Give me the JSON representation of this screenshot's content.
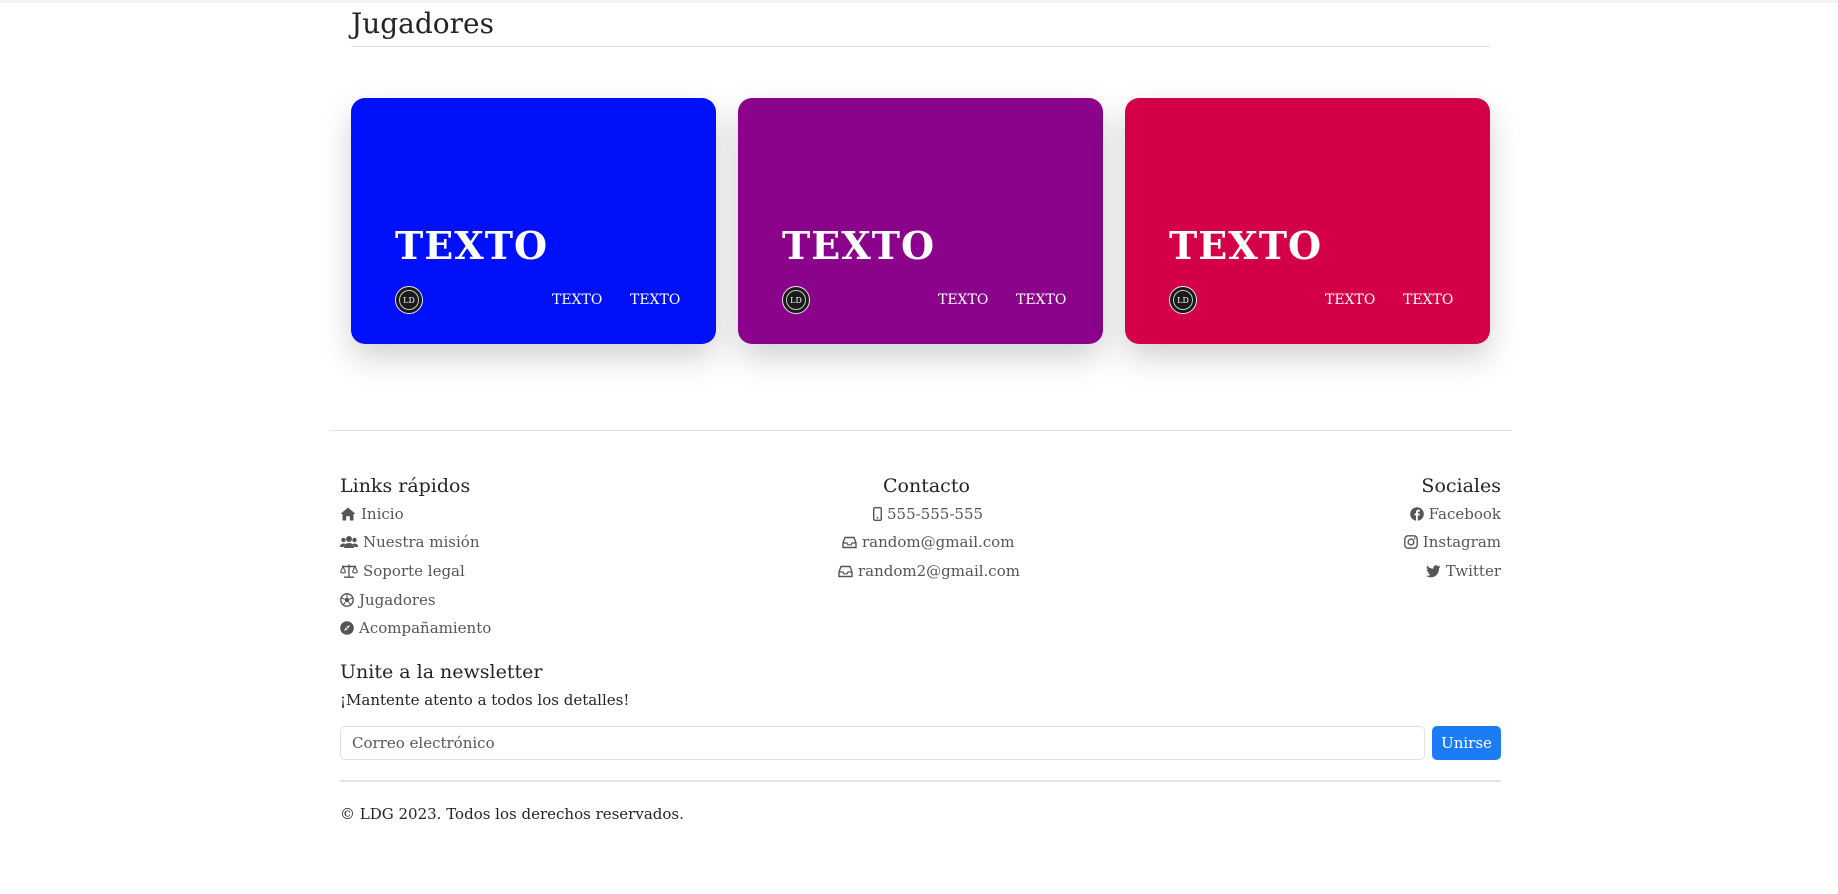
{
  "page": {
    "title": "Jugadores"
  },
  "cards": [
    {
      "color": "#0010fb",
      "title": "TEXTO",
      "logo_text": "LD",
      "link1": "TEXTO",
      "link2": "TEXTO"
    },
    {
      "color": "#8a038a",
      "title": "TEXTO",
      "logo_text": "LD",
      "link1": "TEXTO",
      "link2": "TEXTO"
    },
    {
      "color": "#d40047",
      "title": "TEXTO",
      "logo_text": "LD",
      "link1": "TEXTO",
      "link2": "TEXTO"
    }
  ],
  "footer": {
    "quick_links": {
      "heading": "Links rápidos",
      "items": [
        {
          "label": "Inicio",
          "icon": "house-icon"
        },
        {
          "label": "Nuestra misión",
          "icon": "users-icon"
        },
        {
          "label": "Soporte legal",
          "icon": "scale-icon"
        },
        {
          "label": "Jugadores",
          "icon": "soccer-ball-icon"
        },
        {
          "label": "Acompañamiento",
          "icon": "compass-icon"
        }
      ]
    },
    "contact": {
      "heading": "Contacto",
      "items": [
        {
          "label": "555-555-555",
          "icon": "mobile-phone-icon"
        },
        {
          "label": "random@gmail.com",
          "icon": "inbox-icon"
        },
        {
          "label": "random2@gmail.com",
          "icon": "inbox-icon"
        }
      ]
    },
    "socials": {
      "heading": "Sociales",
      "items": [
        {
          "label": "Facebook",
          "icon": "facebook-icon"
        },
        {
          "label": "Instagram",
          "icon": "instagram-icon"
        },
        {
          "label": "Twitter",
          "icon": "twitter-icon"
        }
      ]
    },
    "newsletter": {
      "heading": "Unite a la newsletter",
      "subtitle": "¡Mantente atento a todos los detalles!",
      "placeholder": "Correo electrónico",
      "button": "Unirse",
      "button_color": "#1b7cf5"
    },
    "copyright": "© LDG 2023. Todos los derechos reservados."
  }
}
